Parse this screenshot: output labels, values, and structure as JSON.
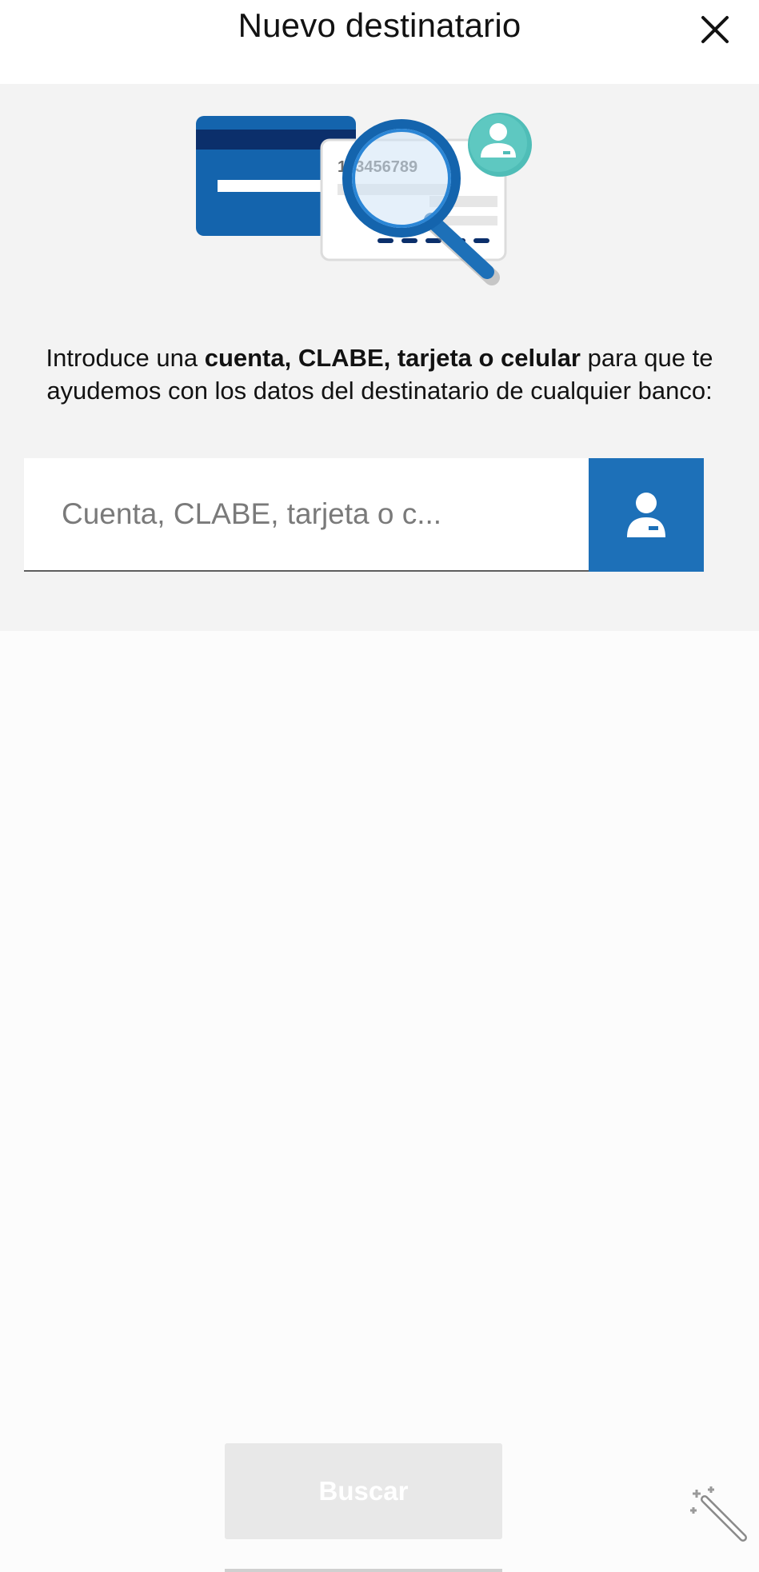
{
  "header": {
    "title": "Nuevo destinatario",
    "close_icon": "close-icon"
  },
  "illustration": {
    "card_number": "123456789",
    "icons": [
      "credit-card-icon",
      "magnifier-icon",
      "user-badge-icon"
    ]
  },
  "instructions": {
    "prefix": "Introduce una ",
    "bold": "cuenta, CLABE, tarjeta o celular",
    "suffix": " para que te ayudemos con los datos del destinatario de cualquier banco:"
  },
  "search": {
    "placeholder": "Cuenta, CLABE, tarjeta o c...",
    "value": "",
    "contacts_icon": "person-icon"
  },
  "actions": {
    "search_label": "Buscar"
  },
  "colors": {
    "brand_blue": "#1d70b8",
    "dark_navy": "#0b2f6b",
    "teal": "#4fbdb7",
    "panel_bg": "#f3f3f3",
    "disabled_button": "#e8e8e8"
  }
}
